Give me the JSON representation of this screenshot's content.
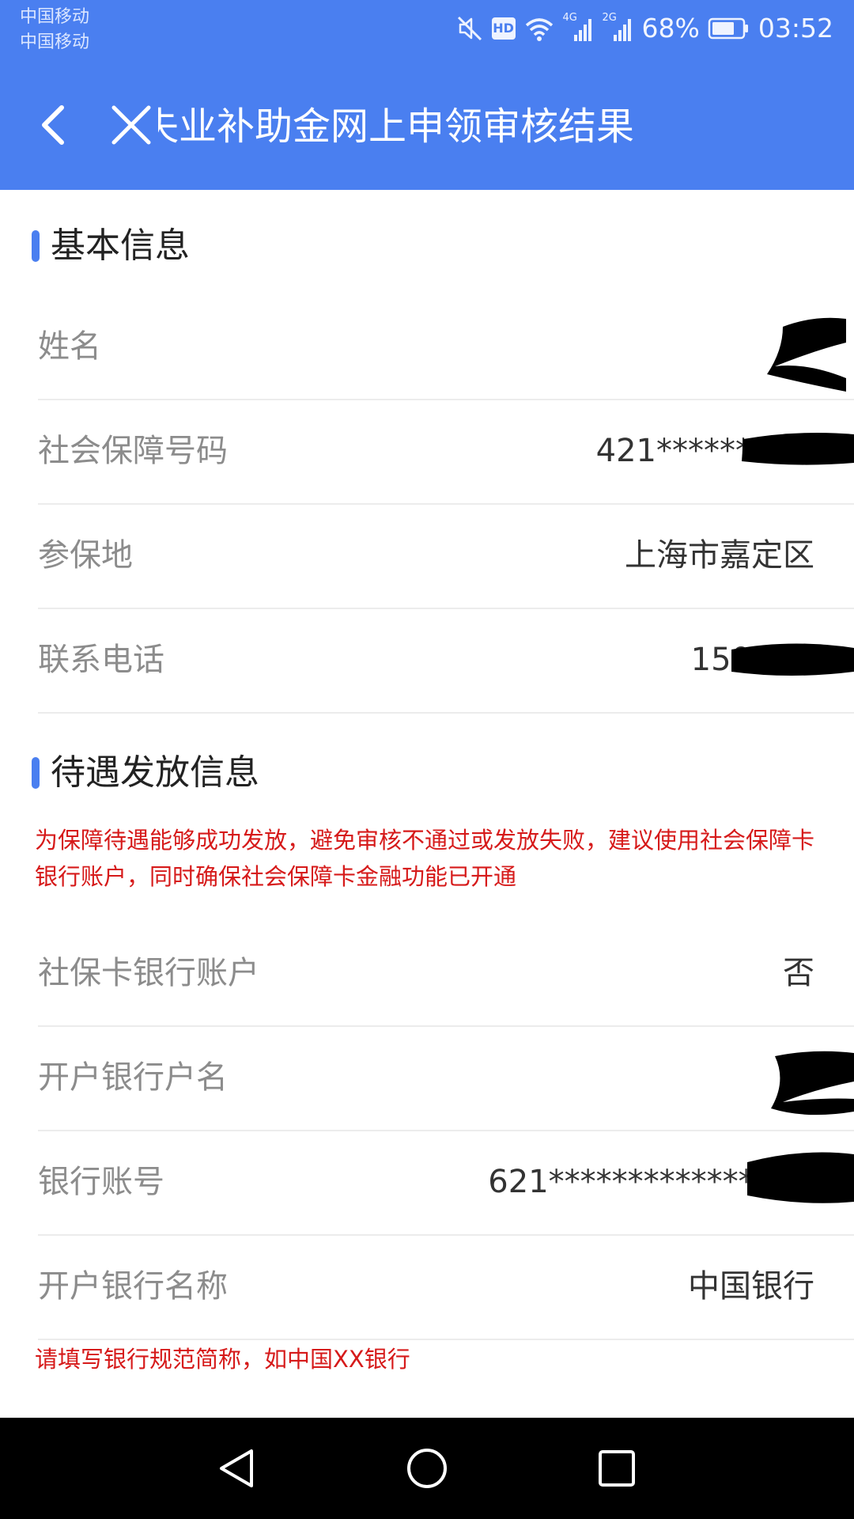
{
  "status_bar": {
    "carrier_1": "中国移动",
    "carrier_2": "中国移动",
    "hd": "HD",
    "net_1": "4G",
    "net_2": "2G",
    "battery": "68%",
    "time": "03:52",
    "icons": [
      "mute-icon",
      "hd-icon",
      "wifi-icon",
      "signal-4g-icon",
      "signal-2g-icon",
      "battery-icon"
    ]
  },
  "header": {
    "title": "失业补助金网上申领审核结果",
    "icons": [
      "back-arrow-icon",
      "close-icon"
    ]
  },
  "basic_info": {
    "heading": "基本信息",
    "rows": [
      {
        "label": "姓名",
        "value": ""
      },
      {
        "label": "社会保障号码",
        "value": "421**********"
      },
      {
        "label": "参保地",
        "value": "上海市嘉定区"
      },
      {
        "label": "联系电话",
        "value": "150****"
      }
    ]
  },
  "benefit_info": {
    "heading": "待遇发放信息",
    "notice": "为保障待遇能够成功发放，避免审核不通过或发放失败，建议使用社会保障卡银行账户，同时确保社会保障卡金融功能已开通",
    "rows": [
      {
        "label": "社保卡银行账户",
        "value": "否"
      },
      {
        "label": "开户银行户名",
        "value": ""
      },
      {
        "label": "银行账号",
        "value": "621*************002"
      },
      {
        "label": "开户银行名称",
        "value": "中国银行"
      }
    ],
    "bank_hint": "请填写银行规范简称，如中国XX银行"
  },
  "nav_bar": {
    "icons": [
      "nav-back-icon",
      "nav-home-icon",
      "nav-recent-icon"
    ]
  },
  "colors": {
    "header_bg": "#4a7ff0",
    "accent_bar": "#4a7ff0",
    "notice_red": "#d61a1a",
    "label_gray": "#8c8c8c"
  }
}
